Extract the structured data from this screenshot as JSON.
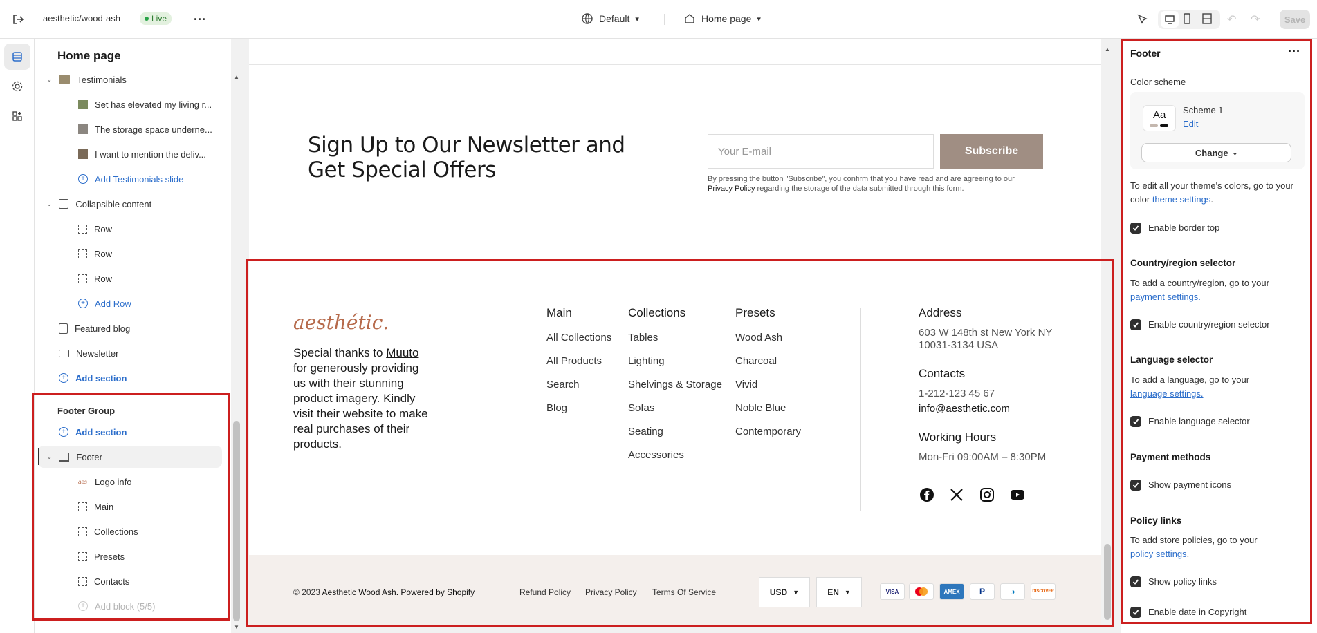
{
  "topbar": {
    "store_name": "aesthetic/wood-ash",
    "live_badge": "Live",
    "theme_selector": "Default",
    "page_selector": "Home page",
    "save_label": "Save"
  },
  "left_panel": {
    "title": "Home page",
    "items": [
      {
        "label": "Testimonials",
        "icon": "image-icon"
      },
      {
        "label": "Set has elevated my living r...",
        "icon": "image-thumb-icon"
      },
      {
        "label": "The storage space underne...",
        "icon": "image-thumb-icon"
      },
      {
        "label": "I want to mention the deliv...",
        "icon": "image-thumb-icon"
      },
      {
        "label": "Add Testimonials slide",
        "icon": "plus-circle-icon"
      },
      {
        "label": "Collapsible content",
        "icon": "text-block-icon"
      },
      {
        "label": "Row",
        "icon": "block-icon"
      },
      {
        "label": "Row",
        "icon": "block-icon"
      },
      {
        "label": "Row",
        "icon": "block-icon"
      },
      {
        "label": "Add Row",
        "icon": "plus-circle-icon"
      },
      {
        "label": "Featured blog",
        "icon": "blog-icon"
      },
      {
        "label": "Newsletter",
        "icon": "mail-icon"
      },
      {
        "label": "Add section",
        "icon": "plus-circle-icon"
      }
    ],
    "footer_group": {
      "title": "Footer Group",
      "add_section": "Add section",
      "footer": "Footer",
      "blocks": [
        "Logo info",
        "Main",
        "Collections",
        "Presets",
        "Contacts"
      ],
      "add_block": "Add block (5/5)"
    }
  },
  "preview": {
    "newsletter": {
      "title": "Sign Up to Our Newsletter and Get Special Offers",
      "email_placeholder": "Your E-mail",
      "subscribe": "Subscribe",
      "fine_print_1": "By pressing the button \"Subscribe\", you confirm that you have read and are agreeing to our",
      "fine_print_link": "Privacy Policy",
      "fine_print_2": "regarding the storage of the data submitted through this form."
    },
    "footer": {
      "logo": "aesthétic.",
      "thanks_1": "Special thanks to",
      "thanks_link": "Muuto",
      "thanks_2": "for generously providing us with their stunning product imagery. Kindly visit their website to make real purchases of their products.",
      "columns": [
        {
          "heading": "Main",
          "links": [
            "All Collections",
            "All Products",
            "Search",
            "Blog"
          ]
        },
        {
          "heading": "Collections",
          "links": [
            "Tables",
            "Lighting",
            "Shelvings & Storage",
            "Sofas",
            "Seating",
            "Accessories"
          ]
        },
        {
          "heading": "Presets",
          "links": [
            "Wood Ash",
            "Charcoal",
            "Vivid",
            "Noble Blue",
            "Contemporary"
          ]
        }
      ],
      "address_h": "Address",
      "address_1": "603 W 148th st New York NY",
      "address_2": "10031-3134 USA",
      "contacts_h": "Contacts",
      "phone": "1-212-123 45 67",
      "email": "info@aesthetic.com",
      "hours_h": "Working Hours",
      "hours": "Mon-Fri 09:00AM – 8:30PM",
      "social": [
        "facebook-icon",
        "x-icon",
        "instagram-icon",
        "youtube-icon"
      ]
    },
    "bottom": {
      "copyright_1": "© 2023",
      "copyright_store": "Aesthetic Wood Ash",
      "copyright_2": ". Powered by Shopify",
      "policies": [
        "Refund Policy",
        "Privacy Policy",
        "Terms Of Service"
      ],
      "currency": "USD",
      "language": "EN",
      "payments": [
        "VISA",
        "MC",
        "AMEX",
        "PayPal",
        "Diners",
        "DISCOVER"
      ]
    }
  },
  "right_panel": {
    "title": "Footer",
    "color_scheme_label": "Color scheme",
    "scheme_preview": "Aa",
    "scheme_name": "Scheme 1",
    "scheme_edit": "Edit",
    "change_label": "Change",
    "theme_hint_1": "To edit all your theme's colors, go to your color",
    "theme_hint_link": "theme settings",
    "enable_border_top": "Enable border top",
    "country_h": "Country/region selector",
    "country_hint": "To add a country/region, go to your",
    "country_link": "payment settings.",
    "enable_country": "Enable country/region selector",
    "language_h": "Language selector",
    "language_hint": "To add a language, go to your",
    "language_link": "language settings.",
    "enable_language": "Enable language selector",
    "payment_h": "Payment methods",
    "show_payment": "Show payment icons",
    "policy_h": "Policy links",
    "policy_hint": "To add store policies, go to your",
    "policy_link": "policy settings",
    "show_policy": "Show policy links",
    "enable_date": "Enable date in Copyright"
  },
  "colors": {
    "accent": "#2c6ecb",
    "subscribe_bg": "#a08e83",
    "logo": "#b66a4b",
    "highlight_border": "#cc1f1f",
    "bottom_bar": "#f4efec"
  }
}
